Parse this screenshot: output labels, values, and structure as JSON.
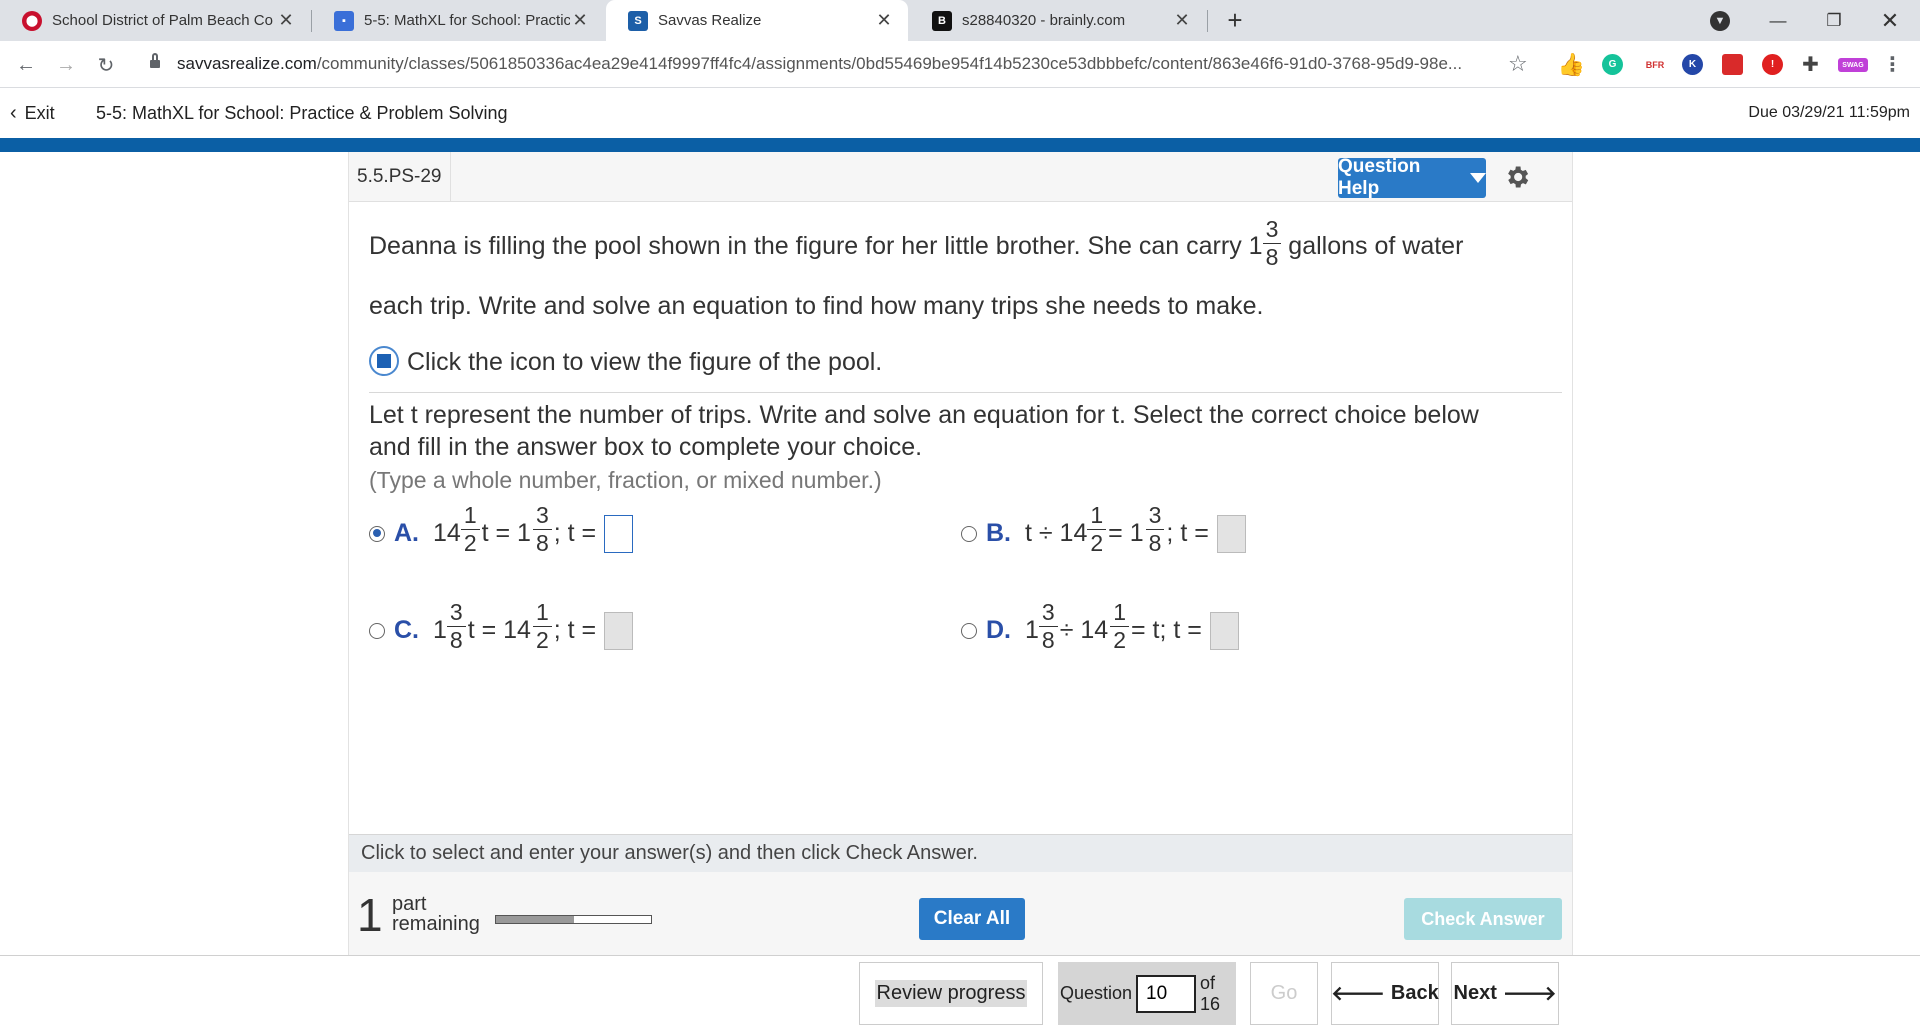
{
  "browser": {
    "tabs": [
      {
        "title": "School District of Palm Beach Co",
        "favicon_color": "#c8102e",
        "favicon_letter": ""
      },
      {
        "title": "5-5: MathXL for School: Practice",
        "favicon_color": "#3a6fd8",
        "favicon_letter": ""
      },
      {
        "title": "Savvas Realize",
        "favicon_color": "#1d5fa8",
        "favicon_letter": "S"
      },
      {
        "title": "s28840320 - brainly.com",
        "favicon_color": "#111111",
        "favicon_letter": "B"
      }
    ],
    "active_tab_index": 2,
    "url_host": "savvasrealize.com",
    "url_path": "/community/classes/5061850336ac4ea29e414f9997ff4fc4/assignments/0bd55469be954f14b5230ce53dbbbefc/content/863e46f6-91d0-3768-95d9-98e...",
    "extensions": [
      {
        "name": "thumbs-up-extension-icon",
        "color": "#f0b400",
        "letter": ""
      },
      {
        "name": "grammarly-extension-icon",
        "color": "#15c39a",
        "letter": "G"
      },
      {
        "name": "bfr-extension-icon",
        "color": "#ffffff",
        "letter": "BFR"
      },
      {
        "name": "k-extension-icon",
        "color": "#2447a8",
        "letter": "K"
      },
      {
        "name": "red-extension-icon",
        "color": "#d92a2a",
        "letter": ""
      },
      {
        "name": "alert-extension-icon",
        "color": "#e02020",
        "letter": "!"
      },
      {
        "name": "puzzle-extension-icon",
        "color": "#444444",
        "letter": ""
      },
      {
        "name": "swag-extension-icon",
        "color": "#c040d8",
        "letter": "SWAG"
      }
    ]
  },
  "header": {
    "exit_label": "Exit",
    "assignment_title": "5-5: MathXL for School: Practice & Problem Solving",
    "due": "Due 03/29/21 11:59pm"
  },
  "question": {
    "id": "5.5.PS-29",
    "help_label": "Question Help",
    "problem_part1": "Deanna is filling the pool shown in the figure for her little brother. She can carry 1",
    "carry_frac": {
      "num": "3",
      "den": "8"
    },
    "problem_part2": " gallons of water",
    "problem_line2": "each trip. Write and solve an equation to find how many trips she needs to make.",
    "figure_link": "Click the icon to view the figure of the pool.",
    "prompt_line1": "Let t represent the number of trips. Write and solve an equation for t. Select the correct choice below",
    "prompt_line2": "and fill in the answer box to complete your choice.",
    "hint": "(Type a whole number, fraction, or mixed number.)",
    "choices": {
      "a": {
        "letter": "A.",
        "w1": "14",
        "n1": "1",
        "d1": "2",
        "mid": "t = 1",
        "n2": "3",
        "d2": "8",
        "tail": ";  t =",
        "selected": true
      },
      "b": {
        "letter": "B.",
        "pre": "t ÷ 14",
        "n1": "1",
        "d1": "2",
        "mid": "= 1",
        "n2": "3",
        "d2": "8",
        "tail": ";  t =",
        "selected": false
      },
      "c": {
        "letter": "C.",
        "w1": "1",
        "n1": "3",
        "d1": "8",
        "mid": "t = 14",
        "n2": "1",
        "d2": "2",
        "tail": ";  t =",
        "selected": false
      },
      "d": {
        "letter": "D.",
        "w1": "1",
        "n1": "3",
        "d1": "8",
        "mid": "÷ 14",
        "n2": "1",
        "d2": "2",
        "tail": "= t;  t =",
        "selected": false
      }
    },
    "instruction": "Click to select and enter your answer(s) and then click Check Answer.",
    "parts_remaining": "1",
    "parts_label_1": "part",
    "parts_label_2": "remaining",
    "progress": 0.5,
    "clear_all": "Clear All",
    "check_answer": "Check Answer"
  },
  "footer": {
    "review": "Review progress",
    "question_label": "Question",
    "question_number": "10",
    "of_total": "of 16",
    "go": "Go",
    "back": "Back",
    "next": "Next"
  }
}
